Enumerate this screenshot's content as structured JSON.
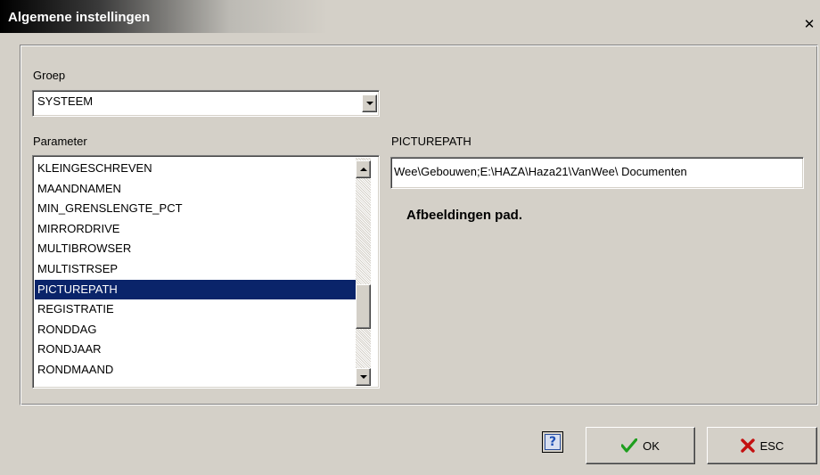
{
  "window": {
    "title": "Algemene instellingen",
    "close_glyph": "✕"
  },
  "groep": {
    "label": "Groep",
    "value": "SYSTEEM"
  },
  "parameter": {
    "label": "Parameter",
    "items": [
      "KLEINGESCHREVEN",
      "MAANDNAMEN",
      "MIN_GRENSLENGTE_PCT",
      "MIRRORDRIVE",
      "MULTIBROWSER",
      "MULTISTRSEP",
      "PICTUREPATH",
      "REGISTRATIE",
      "RONDDAG",
      "RONDJAAR",
      "RONDMAAND"
    ],
    "selected": "PICTUREPATH"
  },
  "detail": {
    "name": "PICTUREPATH",
    "value": "Wee\\Gebouwen;E:\\HAZA\\Haza21\\VanWee\\ Documenten",
    "description": "Afbeeldingen pad."
  },
  "buttons": {
    "help_glyph": "?",
    "ok_label": "OK",
    "esc_label": "ESC"
  },
  "colors": {
    "selection": "#0a246a",
    "ok_icon": "#1e9e1e",
    "esc_icon": "#c41010"
  },
  "icons": {
    "ok": "checkmark-icon",
    "esc": "x-mark-icon",
    "help": "help-icon"
  }
}
